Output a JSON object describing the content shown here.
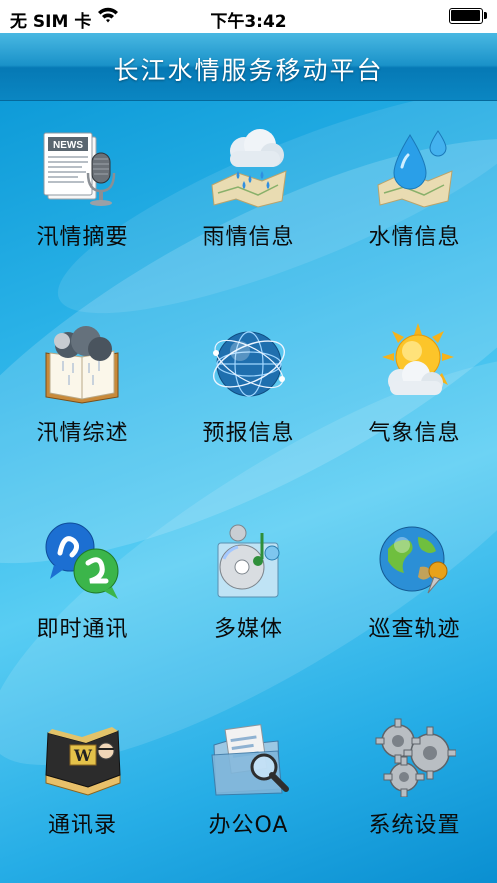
{
  "status_bar": {
    "carrier": "无 SIM 卡",
    "time": "下午3:42"
  },
  "header": {
    "title": "长江水情服务移动平台"
  },
  "menu": [
    {
      "label": "汛情摘要",
      "icon": "news-microphone-icon",
      "badge": "NEWS"
    },
    {
      "label": "雨情信息",
      "icon": "rain-cloud-map-icon"
    },
    {
      "label": "水情信息",
      "icon": "water-drop-map-icon"
    },
    {
      "label": "汛情综述",
      "icon": "storm-book-icon"
    },
    {
      "label": "预报信息",
      "icon": "globe-network-icon"
    },
    {
      "label": "气象信息",
      "icon": "sun-cloud-icon"
    },
    {
      "label": "即时通讯",
      "icon": "chat-bubbles-icon"
    },
    {
      "label": "多媒体",
      "icon": "multimedia-disc-icon"
    },
    {
      "label": "巡查轨迹",
      "icon": "globe-pin-icon"
    },
    {
      "label": "通讯录",
      "icon": "address-book-icon",
      "badge": "W"
    },
    {
      "label": "办公OA",
      "icon": "folder-search-icon"
    },
    {
      "label": "系统设置",
      "icon": "gears-icon"
    }
  ],
  "colors": {
    "header_blue": "#1a92c9",
    "background_blue": "#2fb6ea",
    "label_text": "#0b0b0b"
  }
}
